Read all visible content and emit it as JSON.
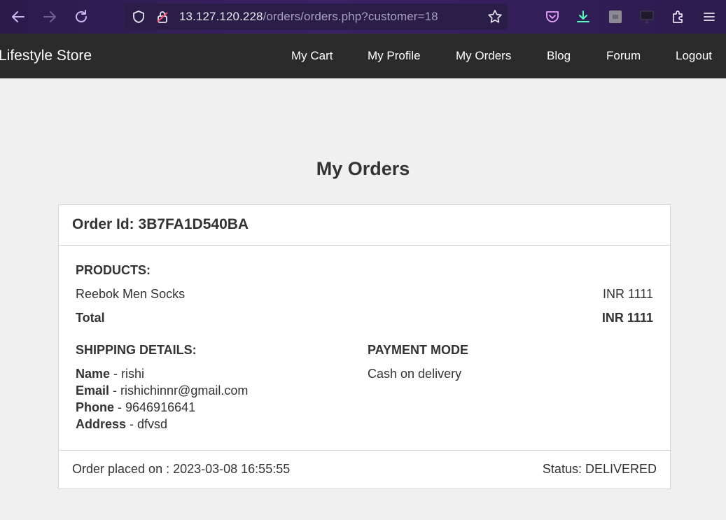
{
  "browser": {
    "url_host": "13.127.120.228",
    "url_path": "/orders/orders.php?customer=18",
    "icons": [
      "back-icon",
      "forward-icon",
      "reload-icon",
      "shield-icon",
      "lock-icon",
      "star-icon",
      "pocket-icon",
      "download-icon",
      "extension-box-icon",
      "screen-icon",
      "puzzle-icon",
      "menu-icon"
    ]
  },
  "site": {
    "brand": "Lifestyle Store",
    "nav": {
      "cart": "My Cart",
      "profile": "My Profile",
      "orders": "My Orders",
      "blog": "Blog",
      "forum": "Forum",
      "logout": "Logout"
    }
  },
  "main": {
    "title": "My Orders",
    "order": {
      "id_label": "Order Id: 3B7FA1D540BA",
      "products_label": "PRODUCTS:",
      "products": [
        {
          "name": "Reebok Men Socks",
          "price": "INR 1111"
        }
      ],
      "total_label": "Total",
      "total_value": "INR 1111",
      "shipping_label": "SHIPPING DETAILS:",
      "shipping": {
        "name_label": "Name",
        "name_value": " - rishi",
        "email_label": "Email",
        "email_value": " - rishichinnr@gmail.com",
        "phone_label": "Phone",
        "phone_value": " - 9646916641",
        "address_label": "Address",
        "address_value": " - dfvsd"
      },
      "payment_label": "PAYMENT MODE",
      "payment_value": "Cash on delivery",
      "placed_on": "Order placed on : 2023-03-08 16:55:55",
      "status": "Status: DELIVERED"
    }
  }
}
